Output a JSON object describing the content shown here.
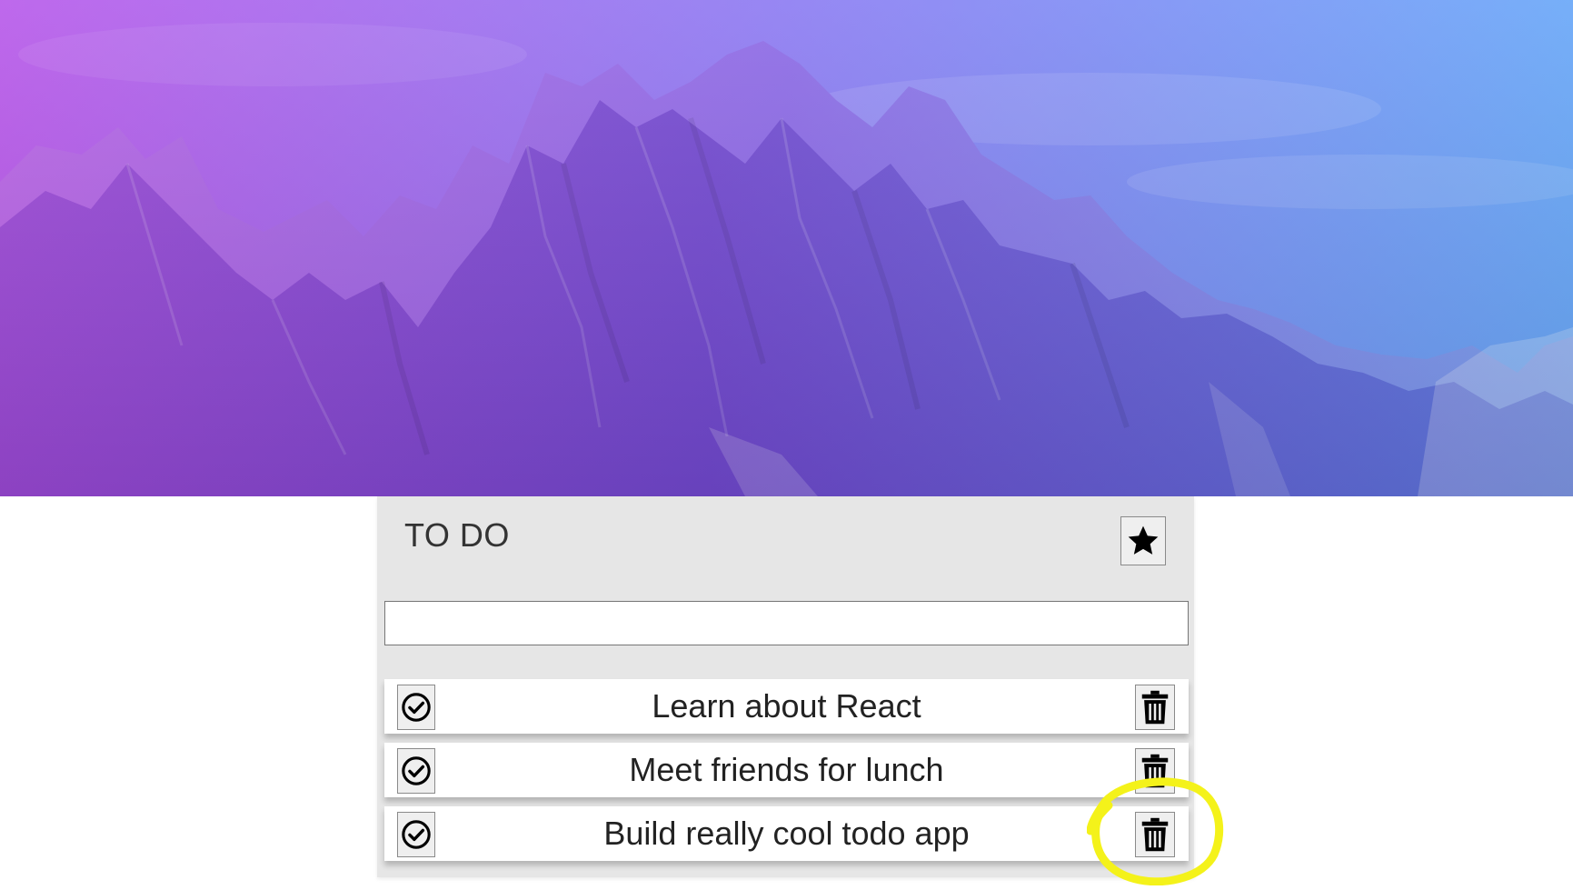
{
  "app": {
    "title": "TO DO",
    "star_icon": "star-icon"
  },
  "new_todo": {
    "value": "",
    "placeholder": ""
  },
  "todos": [
    {
      "text": "Learn about React",
      "check_icon": "check-circle-icon",
      "delete_icon": "trash-icon"
    },
    {
      "text": "Meet friends for lunch",
      "check_icon": "check-circle-icon",
      "delete_icon": "trash-icon"
    },
    {
      "text": "Build really cool todo app",
      "check_icon": "check-circle-icon",
      "delete_icon": "trash-icon"
    }
  ],
  "annotation": {
    "type": "hand-drawn-circle",
    "color": "#f4f21a",
    "target": "delete button of third todo"
  },
  "colors": {
    "hero_gradient_start": "#b04ee8",
    "hero_gradient_mid": "#7b6cf0",
    "hero_gradient_end": "#5f9ef7",
    "panel_bg": "#e6e6e6",
    "item_bg": "#ffffff"
  }
}
